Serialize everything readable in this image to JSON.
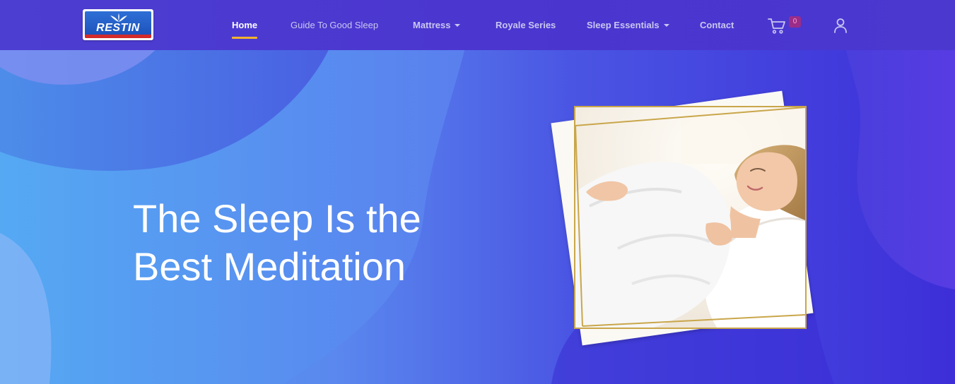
{
  "brand": {
    "logo_text": "RESTIN"
  },
  "nav": {
    "items": [
      {
        "label": "Home",
        "active": true,
        "dropdown": false
      },
      {
        "label": "Guide To Good Sleep",
        "active": false,
        "dropdown": false
      },
      {
        "label": "Mattress",
        "active": false,
        "dropdown": true
      },
      {
        "label": "Royale Series",
        "active": false,
        "dropdown": false
      },
      {
        "label": "Sleep Essentials",
        "active": false,
        "dropdown": true
      },
      {
        "label": "Contact",
        "active": false,
        "dropdown": false
      }
    ],
    "cart_count": "0",
    "icons": [
      "cart-icon",
      "user-icon"
    ]
  },
  "hero": {
    "headline_line1": "The Sleep Is the",
    "headline_line2": "Best Meditation"
  },
  "colors": {
    "nav_bg": "#4b39cf",
    "accent_underline": "#f3b32b",
    "frame_gold": "#c9a64a",
    "hero_gradient_start": "#52a6f2",
    "hero_gradient_end": "#3d2ed8"
  }
}
